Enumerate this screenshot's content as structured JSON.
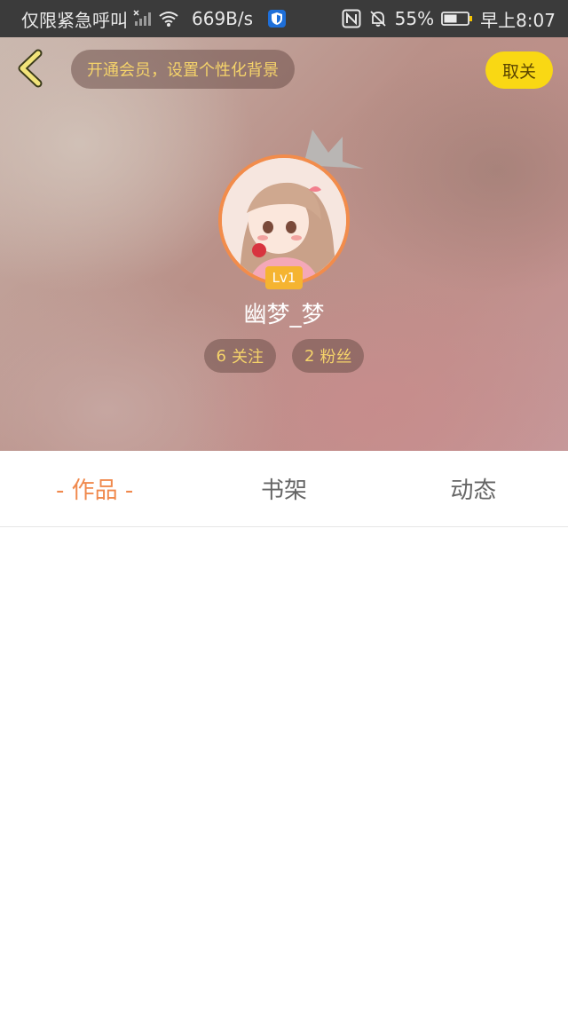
{
  "status_bar": {
    "carrier": "仅限紧急呼叫",
    "speed": "669B/s",
    "nfc": "N",
    "battery": "55%",
    "time": "早上8:07"
  },
  "header": {
    "vip_banner": "开通会员，设置个性化背景",
    "unfollow_label": "取关"
  },
  "profile": {
    "level": "Lv1",
    "username": "幽梦_梦",
    "following_count": "6",
    "following_label": "关注",
    "fans_count": "2",
    "fans_label": "粉丝"
  },
  "tabs": [
    {
      "label": "- 作品 -",
      "active": true
    },
    {
      "label": "书架",
      "active": false
    },
    {
      "label": "动态",
      "active": false
    }
  ],
  "colors": {
    "accent": "#f0894d",
    "button_yellow": "#f9d814",
    "pill_text": "#f5d36a",
    "status_bar": "#3b3b3b"
  }
}
